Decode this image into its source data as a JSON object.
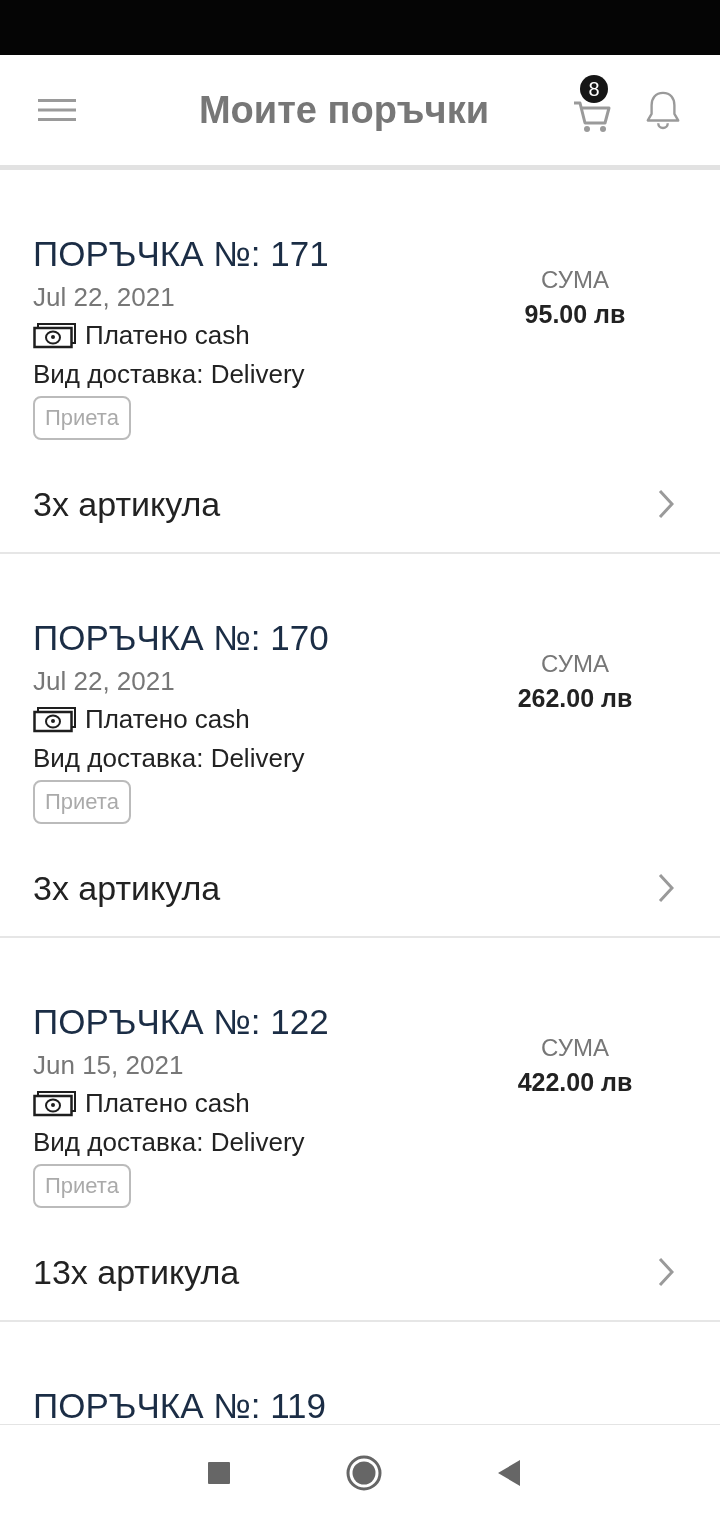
{
  "header": {
    "title": "Моите поръчки",
    "cart_count": "8"
  },
  "orders": [
    {
      "title": "ПОРЪЧКА №: 171",
      "date": "Jul 22, 2021",
      "payment": "Платено cash",
      "delivery": "Вид доставка: Delivery",
      "status": "Приета",
      "sum_label": "СУМА",
      "sum": "95.00 лв",
      "items": "3х артикула"
    },
    {
      "title": "ПОРЪЧКА №: 170",
      "date": "Jul 22, 2021",
      "payment": "Платено cash",
      "delivery": "Вид доставка: Delivery",
      "status": "Приета",
      "sum_label": "СУМА",
      "sum": "262.00 лв",
      "items": "3х артикула"
    },
    {
      "title": "ПОРЪЧКА №: 122",
      "date": "Jun 15, 2021",
      "payment": "Платено cash",
      "delivery": "Вид доставка: Delivery",
      "status": "Приета",
      "sum_label": "СУМА",
      "sum": "422.00 лв",
      "items": "13х артикула"
    },
    {
      "title": "ПОРЪЧКА №: 119"
    }
  ]
}
